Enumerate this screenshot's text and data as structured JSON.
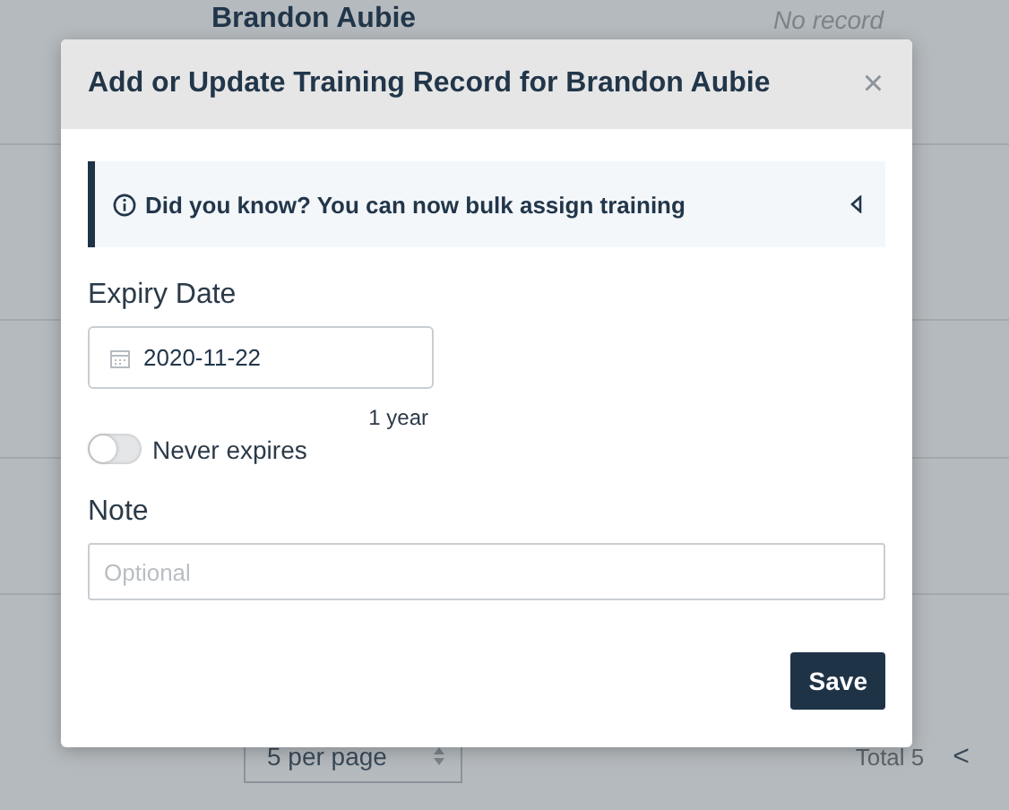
{
  "background": {
    "row": {
      "name": "Brandon Aubie",
      "status": "No record"
    },
    "pagination": {
      "per_page": "5 per page",
      "total": "Total 5",
      "prev": "<"
    }
  },
  "dialog": {
    "title": "Add or Update Training Record for Brandon Aubie",
    "close": "×",
    "callout": {
      "text": "Did you know? You can now bulk assign training",
      "expanded": false
    },
    "expiry": {
      "label": "Expiry Date",
      "value": "2020-11-22",
      "hint": "1 year"
    },
    "never_expires": {
      "label": "Never expires",
      "on": false
    },
    "note": {
      "label": "Note",
      "placeholder": "Optional"
    },
    "save": "Save"
  }
}
